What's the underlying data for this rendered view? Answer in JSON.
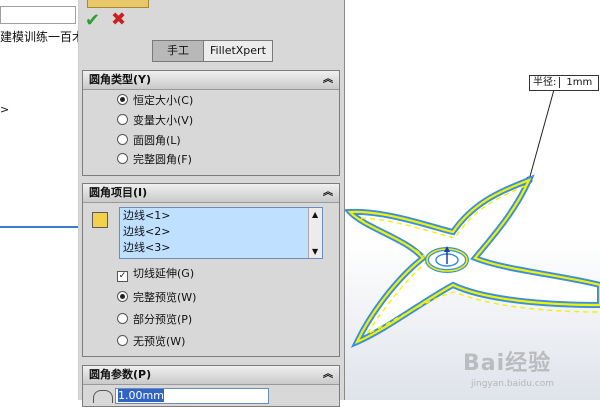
{
  "tree": {
    "search_value": "",
    "item_text": "建模训练一百术",
    "arrow": ">"
  },
  "pm": {
    "ok_icon": "check-icon",
    "cancel_icon": "close-icon",
    "tabs": [
      {
        "label": "手工",
        "active": true
      },
      {
        "label": "FilletXpert",
        "active": false
      }
    ],
    "fillet_type": {
      "header": "圆角类型(Y)",
      "options": [
        {
          "label": "恒定大小(C)",
          "selected": true
        },
        {
          "label": "变量大小(V)",
          "selected": false
        },
        {
          "label": "面圆角(L)",
          "selected": false
        },
        {
          "label": "完整圆角(F)",
          "selected": false
        }
      ]
    },
    "fillet_items": {
      "header": "圆角项目(I)",
      "edges": [
        "边线<1>",
        "边线<2>",
        "边线<3>"
      ],
      "tangent_propagation": {
        "label": "切线延伸(G)",
        "checked": true
      },
      "preview": [
        {
          "label": "完整预览(W)",
          "selected": true
        },
        {
          "label": "部分预览(P)",
          "selected": false
        },
        {
          "label": "无预览(W)",
          "selected": false
        }
      ]
    },
    "fillet_params": {
      "header": "圆角参数(P)",
      "radius_value": "1.00mm"
    }
  },
  "graphics": {
    "callout_label": "半径:",
    "callout_value": "1mm",
    "accent_yellow": "#f2f200",
    "accent_blue": "#3a8fe0"
  },
  "watermark": {
    "text": "Bai经验",
    "url": "jingyan.baidu.com"
  }
}
